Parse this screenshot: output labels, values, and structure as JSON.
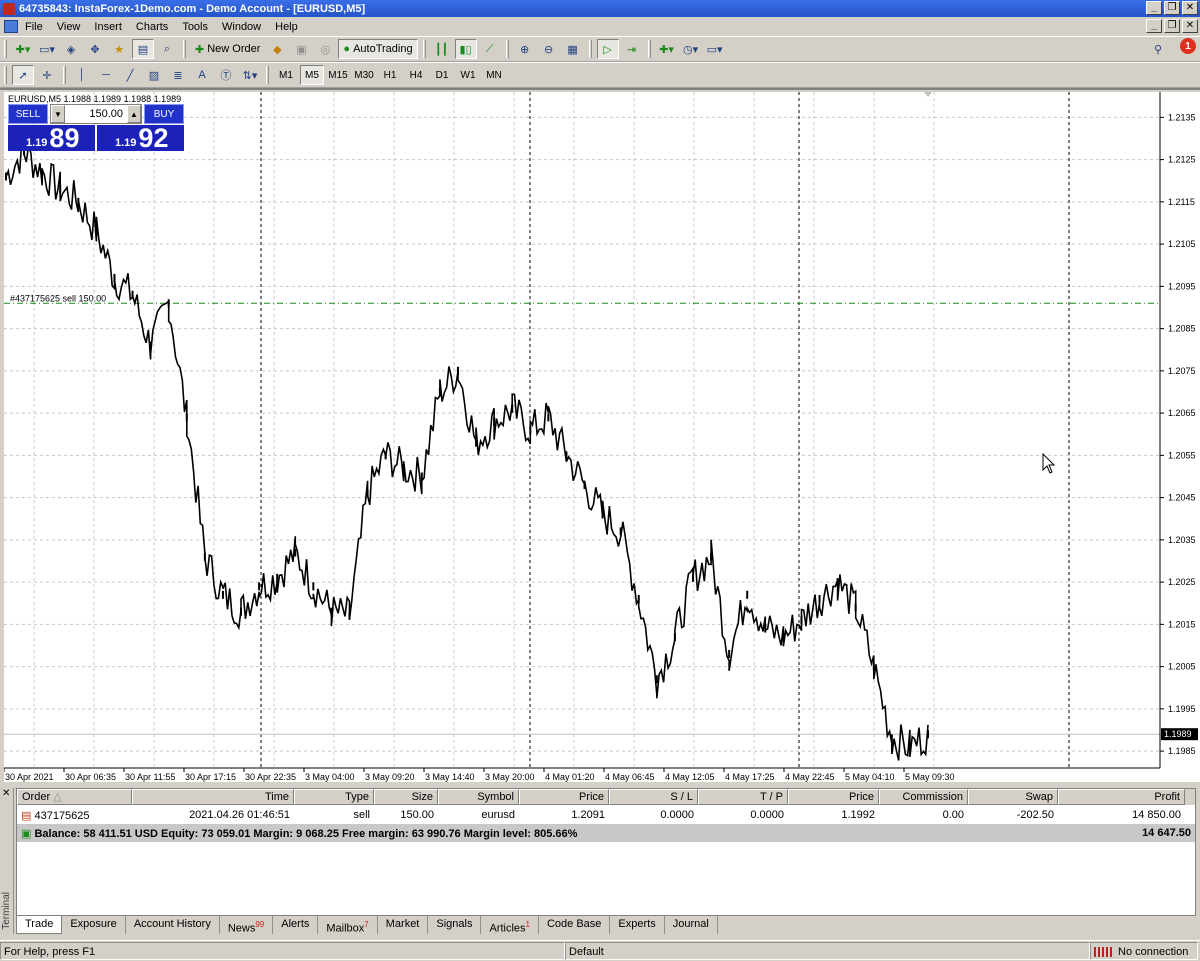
{
  "window": {
    "title": "64735843: InstaForex-1Demo.com - Demo Account - [EURUSD,M5]"
  },
  "menu": [
    "File",
    "View",
    "Insert",
    "Charts",
    "Tools",
    "Window",
    "Help"
  ],
  "toolbar1": {
    "new_order": "New Order",
    "autotrading": "AutoTrading",
    "alert_count": "1"
  },
  "toolbar2": {
    "timeframes": [
      "M1",
      "M5",
      "M15",
      "M30",
      "H1",
      "H4",
      "D1",
      "W1",
      "MN"
    ],
    "active": "M5"
  },
  "chart": {
    "header": "EURUSD,M5  1.1988 1.1989 1.1988 1.1989",
    "one_click": {
      "sell_label": "SELL",
      "buy_label": "BUY",
      "lot": "150.00",
      "sell_prefix": "1.19",
      "sell_big": "89",
      "buy_prefix": "1.19",
      "buy_big": "92"
    },
    "order_line_label": "#437175625 sell 150.00",
    "current_price_label": "1.1989"
  },
  "chart_data": {
    "type": "line",
    "symbol": "EURUSD",
    "timeframe": "M5",
    "y_ticks": [
      "1.2135",
      "1.2125",
      "1.2115",
      "1.2105",
      "1.2095",
      "1.2085",
      "1.2075",
      "1.2065",
      "1.2055",
      "1.2045",
      "1.2035",
      "1.2025",
      "1.2015",
      "1.2005",
      "1.1995",
      "1.1985"
    ],
    "x_ticks": [
      "30 Apr 2021",
      "30 Apr 06:35",
      "30 Apr 11:55",
      "30 Apr 17:15",
      "30 Apr 22:35",
      "3 May 04:00",
      "3 May 09:20",
      "3 May 14:40",
      "3 May 20:00",
      "4 May 01:20",
      "4 May 06:45",
      "4 May 12:05",
      "4 May 17:25",
      "4 May 22:45",
      "5 May 04:10",
      "5 May 09:30"
    ],
    "ylim": [
      1.1981,
      1.2141
    ],
    "grid": true,
    "order_price": 1.2091,
    "current_price": 1.1989,
    "series": [
      {
        "values": [
          1.2121,
          1.2127,
          1.2122,
          1.2118,
          1.2115,
          1.2108,
          1.2097,
          1.2093,
          1.2081,
          1.2091,
          1.2064,
          1.2031,
          1.2022,
          1.2018,
          1.2024,
          1.2026,
          1.2032,
          1.2024,
          1.2018,
          1.2017,
          1.2046,
          1.2055,
          1.2052,
          1.205,
          1.207,
          1.2075,
          1.2058,
          1.2063,
          1.2066,
          1.2061,
          1.2064,
          1.2055,
          1.2048,
          1.2041,
          1.2037,
          1.2021,
          1.2002,
          1.2012,
          1.2026,
          1.2031,
          1.2008,
          1.2022,
          1.2014,
          1.2012,
          1.2016,
          1.2021,
          1.2025,
          1.2019,
          1.2005,
          1.1988,
          1.1986,
          1.1989
        ]
      }
    ]
  },
  "terminal": {
    "side_label": "Terminal",
    "columns": [
      "Order",
      "Time",
      "Type",
      "Size",
      "Symbol",
      "Price",
      "S / L",
      "T / P",
      "Price",
      "Commission",
      "Swap",
      "Profit"
    ],
    "orders": [
      {
        "order": "437175625",
        "time": "2021.04.26 01:46:51",
        "type": "sell",
        "size": "150.00",
        "symbol": "eurusd",
        "price": "1.2091",
        "sl": "0.0000",
        "tp": "0.0000",
        "cur_price": "1.1992",
        "commission": "0.00",
        "swap": "-202.50",
        "profit": "14 850.00"
      }
    ],
    "balance_text": "Balance: 58 411.51 USD  Equity: 73 059.01  Margin: 9 068.25  Free margin: 63 990.76  Margin level: 805.66%",
    "balance_profit": "14 647.50",
    "tabs": [
      {
        "label": "Trade",
        "badge": ""
      },
      {
        "label": "Exposure",
        "badge": ""
      },
      {
        "label": "Account History",
        "badge": ""
      },
      {
        "label": "News",
        "badge": "99"
      },
      {
        "label": "Alerts",
        "badge": ""
      },
      {
        "label": "Mailbox",
        "badge": "7"
      },
      {
        "label": "Market",
        "badge": ""
      },
      {
        "label": "Signals",
        "badge": ""
      },
      {
        "label": "Articles",
        "badge": "1"
      },
      {
        "label": "Code Base",
        "badge": ""
      },
      {
        "label": "Experts",
        "badge": ""
      },
      {
        "label": "Journal",
        "badge": ""
      }
    ]
  },
  "status": {
    "help": "For Help, press F1",
    "profile": "Default",
    "connection": "No connection"
  }
}
